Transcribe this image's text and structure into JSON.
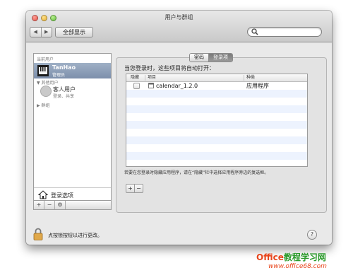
{
  "window": {
    "title": "用户与群组"
  },
  "toolbar": {
    "back": "◀",
    "forward": "▶",
    "show_all_label": "全部显示",
    "search_placeholder": ""
  },
  "sidebar": {
    "current_users_label": "当前用户",
    "current_user": {
      "name": "TanHao",
      "role": "管理员"
    },
    "other_users_label": "其他用户",
    "guest": {
      "name": "客人用户",
      "subtitle": "登录、共享"
    },
    "groups_label": "群组",
    "login_options_label": "登录选项",
    "buttons": {
      "add": "+",
      "remove": "−",
      "settings": "⚙"
    }
  },
  "panel": {
    "tabs": [
      {
        "label": "密码",
        "selected": false
      },
      {
        "label": "登录项",
        "selected": true
      }
    ],
    "heading": "当您登录时，这些项目将自动打开：",
    "table": {
      "columns": [
        "隐藏",
        "项目",
        "种类"
      ],
      "rows": [
        {
          "hide": false,
          "item": "calendar_1.2.0",
          "kind": "应用程序"
        }
      ]
    },
    "hint": "若要在您登录时隐藏应用程序，请在“隐藏”栏中选择应用程序旁边的复选框。",
    "add_label": "+",
    "remove_label": "−"
  },
  "footer": {
    "lock_text": "点按锁按钮以进行更改。",
    "help_label": "?"
  },
  "watermark": {
    "brand_a": "Office",
    "brand_b": "教程学习网",
    "url": "www.office68.com"
  },
  "colors": {
    "selection": "#7d8fab",
    "alt_row": "#edf3fe",
    "watermark": "#e8451c"
  }
}
